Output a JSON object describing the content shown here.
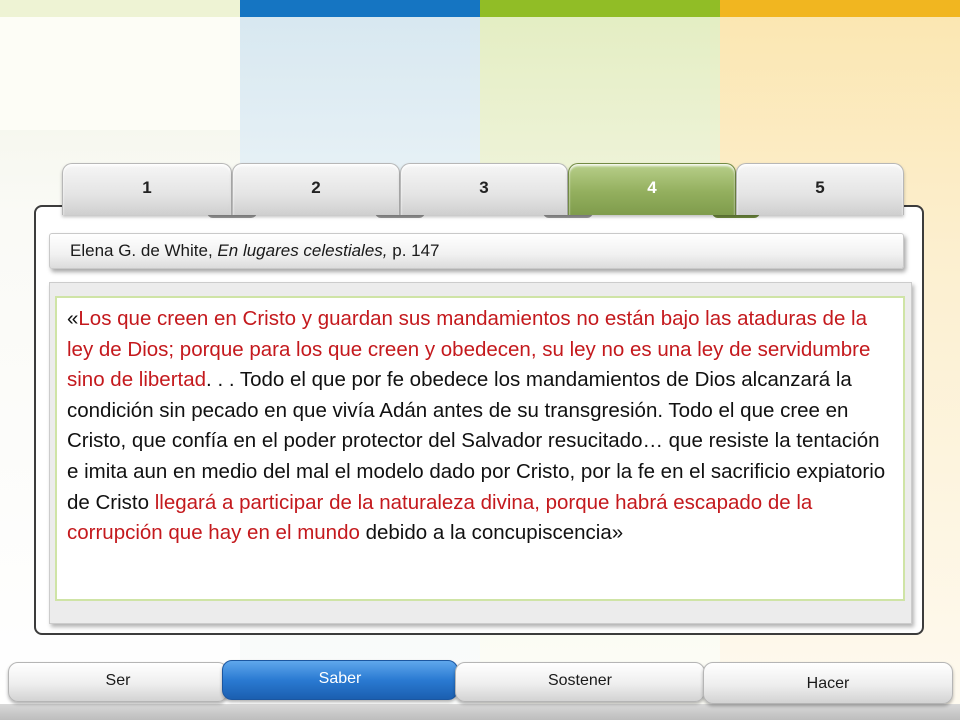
{
  "tabs": [
    {
      "label": "1",
      "active": false
    },
    {
      "label": "2",
      "active": false
    },
    {
      "label": "3",
      "active": false
    },
    {
      "label": "4",
      "active": true
    },
    {
      "label": "5",
      "active": false
    }
  ],
  "source": {
    "author": "Elena G. de White,",
    "book": "En lugares celestiales,",
    "page": "p. 147"
  },
  "quote": {
    "open": "«",
    "red1": "Los que creen en Cristo y guardan sus mandamientos no están bajo las ataduras de la ley de Dios; porque para los que creen y obedecen, su ley no es una ley de servidumbre sino de libertad",
    "black1": ". . . Todo el que por fe obedece los mandamientos de Dios alcanzará la condición sin pecado en que vivía Adán antes de su transgresión. Todo el que cree en Cristo, que confía en el poder protector del Salvador resucitado… que resiste la tentación e imita aun en medio del mal el modelo dado por Cristo, por la fe en el sacrificio expiatorio de Cristo",
    "red2": "llegará a participar de la naturaleza divina, porque habrá escapado de la corrupción que hay en el mundo",
    "black2": "debido a la concupiscencia»"
  },
  "nav": [
    {
      "label": "Ser",
      "active": false
    },
    {
      "label": "Saber",
      "active": true
    },
    {
      "label": "Sostener",
      "active": false
    },
    {
      "label": "Hacer",
      "active": false
    }
  ],
  "colors": {
    "accent_red": "#c4191d",
    "tab_active": "#93af5e",
    "nav_active": "#2a7ad2",
    "bar_blue": "#1575c2",
    "bar_green": "#91bd26",
    "bar_yellow": "#f1b620"
  }
}
